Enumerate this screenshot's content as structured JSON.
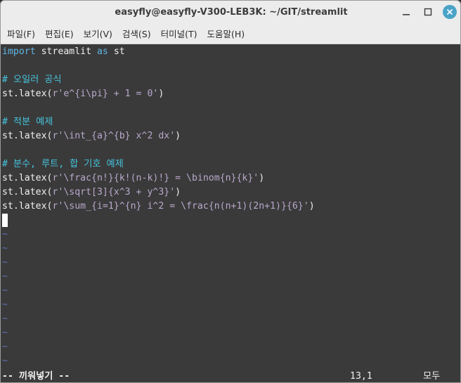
{
  "window": {
    "title": "easyfly@easyfly-V300-LEB3K: ~/GIT/streamlit"
  },
  "menu": [
    "파일(F)",
    "편집(E)",
    "보기(V)",
    "검색(S)",
    "터미널(T)",
    "도움말(H)"
  ],
  "code": {
    "l1": {
      "kw1": "import",
      "mid": " streamlit ",
      "kw2": "as",
      "rest": " st"
    },
    "l3": "# 오일러 공식",
    "l4": {
      "pre": "st.latex(",
      "str": "r'e^{i\\pi} + 1 = 0'",
      "post": ")"
    },
    "l6": "# 적분 예제",
    "l7": {
      "pre": "st.latex(",
      "str": "r'\\int_{a}^{b} x^2 dx'",
      "post": ")"
    },
    "l9": "# 분수, 루트, 합 기호 예제",
    "l10": {
      "pre": "st.latex(",
      "str": "r'\\frac{n!}{k!(n-k)!} = \\binom{n}{k}'",
      "post": ")"
    },
    "l11": {
      "pre": "st.latex(",
      "str": "r'\\sqrt[3]{x^3 + y^3}'",
      "post": ")"
    },
    "l12": {
      "pre": "st.latex(",
      "str": "r'\\sum_{i=1}^{n} i^2 = \\frac{n(n+1)(2n+1)}{6}'",
      "post": ")"
    },
    "tilde": "~"
  },
  "status": {
    "mode": "-- 끼워넣기 --",
    "position": "13,1",
    "scroll": "모두"
  },
  "colors": {
    "keyword": "#5fb6e8",
    "comment": "#45c3dc",
    "string": "#b9a8cc",
    "tilde": "#5d73b8",
    "background": "#3a3a3a"
  },
  "icons": {
    "minimize": "minimize-icon",
    "maximize": "maximize-icon",
    "close": "close-icon"
  }
}
